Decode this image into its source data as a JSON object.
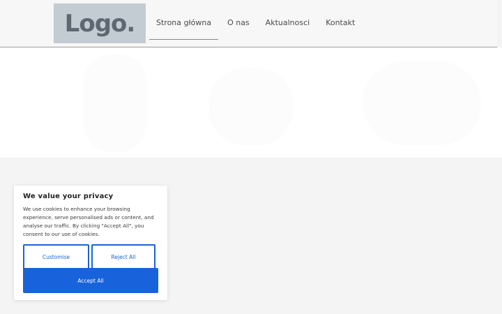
{
  "header": {
    "logo_text": "Logo.",
    "nav": [
      {
        "label": "Strona główna",
        "active": true
      },
      {
        "label": "O nas",
        "active": false
      },
      {
        "label": "Aktualnosci",
        "active": false
      },
      {
        "label": "Kontakt",
        "active": false
      }
    ]
  },
  "cookie_banner": {
    "title": "We value your privacy",
    "text": "We use cookies to enhance your browsing experience, serve personalised ads or content, and analyse our traffic. By clicking \"Accept All\", you consent to our use of cookies.",
    "customise_label": "Customise",
    "reject_label": "Reject All",
    "accept_label": "Accept All",
    "accent_color": "#1863dc"
  }
}
